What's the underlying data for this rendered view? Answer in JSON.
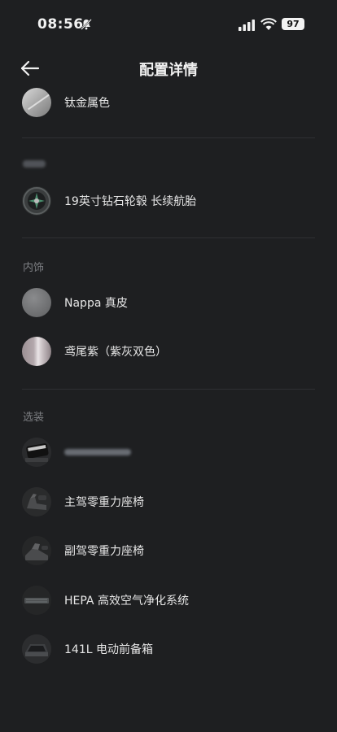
{
  "status": {
    "time": "08:56",
    "battery": "97"
  },
  "header": {
    "title": "配置详情"
  },
  "exterior": {
    "color_label": "钛金属色"
  },
  "wheels": {
    "label": "19英寸钻石轮毂 长续航胎"
  },
  "interior": {
    "section": "内饰",
    "items": [
      {
        "label": "Nappa 真皮"
      },
      {
        "label": "鸢尾紫（紫灰双色）"
      }
    ]
  },
  "options": {
    "section": "选装",
    "items": [
      {
        "label": ""
      },
      {
        "label": "主驾零重力座椅"
      },
      {
        "label": "副驾零重力座椅"
      },
      {
        "label": "HEPA 高效空气净化系统"
      },
      {
        "label": "141L 电动前备箱"
      }
    ]
  }
}
